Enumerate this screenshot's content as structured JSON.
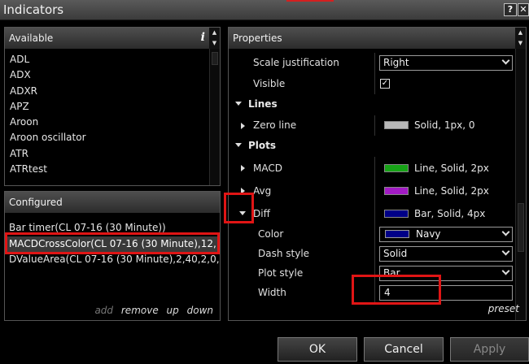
{
  "window": {
    "title": "Indicators",
    "help_label": "?",
    "close_label": "✕"
  },
  "available": {
    "header": "Available",
    "info_label": "i",
    "items": [
      "ADL",
      "ADX",
      "ADXR",
      "APZ",
      "Aroon",
      "Aroon oscillator",
      "ATR",
      "ATRtest"
    ]
  },
  "configured": {
    "header": "Configured",
    "items": [
      "Bar timer(CL 07-16 (30 Minute))",
      "MACDCrossColor(CL 07-16 (30 Minute),12,...",
      "DValueArea(CL 07-16 (30 Minute),2,40,2,0,..."
    ],
    "selected_index": 1,
    "actions": {
      "add": "add",
      "remove": "remove",
      "up": "up",
      "down": "down"
    }
  },
  "properties": {
    "header": "Properties",
    "scale_justification": {
      "label": "Scale justification",
      "value": "Right"
    },
    "visible": {
      "label": "Visible",
      "checked": true,
      "mark": "✓"
    },
    "lines": {
      "label": "Lines"
    },
    "zero_line": {
      "label": "Zero line",
      "value": "Solid, 1px, 0",
      "color": "#b8b8b8"
    },
    "plots": {
      "label": "Plots"
    },
    "macd": {
      "label": "MACD",
      "value": "Line, Solid, 2px",
      "color": "#17a317"
    },
    "avg": {
      "label": "Avg",
      "value": "Line, Solid, 2px",
      "color": "#a21bc4"
    },
    "diff": {
      "label": "Diff",
      "value": "Bar, Solid, 4px",
      "color": "#000088"
    },
    "color": {
      "label": "Color",
      "value": "Navy",
      "color": "#000088"
    },
    "dash_style": {
      "label": "Dash style",
      "value": "Solid"
    },
    "plot_style": {
      "label": "Plot style",
      "value": "Bar"
    },
    "width": {
      "label": "Width",
      "value": "4"
    },
    "preset": "preset"
  },
  "buttons": {
    "ok": "OK",
    "cancel": "Cancel",
    "apply": "Apply"
  },
  "colors": {
    "highlight": "#e01515"
  }
}
